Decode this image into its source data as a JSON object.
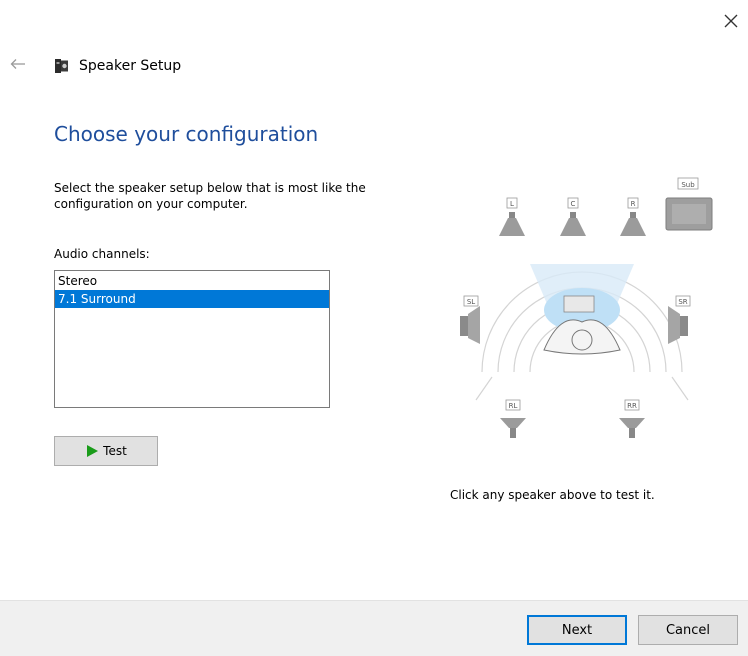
{
  "window": {
    "title": "Speaker Setup",
    "close_icon": "close-icon",
    "back_icon": "back-arrow-icon",
    "app_icon": "speaker-app-icon"
  },
  "page": {
    "heading": "Choose your configuration",
    "instructions": "Select the speaker setup below that is most like the configuration on your computer.",
    "channels_label": "Audio channels:",
    "hint": "Click any speaker above to test it."
  },
  "channels": {
    "items": [
      "Stereo",
      "7.1 Surround"
    ],
    "selected": "7.1 Surround"
  },
  "test_button": {
    "label": "Test",
    "icon": "play-icon",
    "icon_color": "#1a9c1a"
  },
  "speakers": {
    "front_left": "L",
    "center": "C",
    "front_right": "R",
    "subwoofer": "Sub",
    "side_left": "SL",
    "side_right": "SR",
    "rear_left": "RL",
    "rear_right": "RR"
  },
  "footer": {
    "next_label": "Next",
    "cancel_label": "Cancel"
  },
  "colors": {
    "heading": "#1f4e9c",
    "selection": "#0078d7",
    "footer_bg": "#f0f0f0"
  }
}
